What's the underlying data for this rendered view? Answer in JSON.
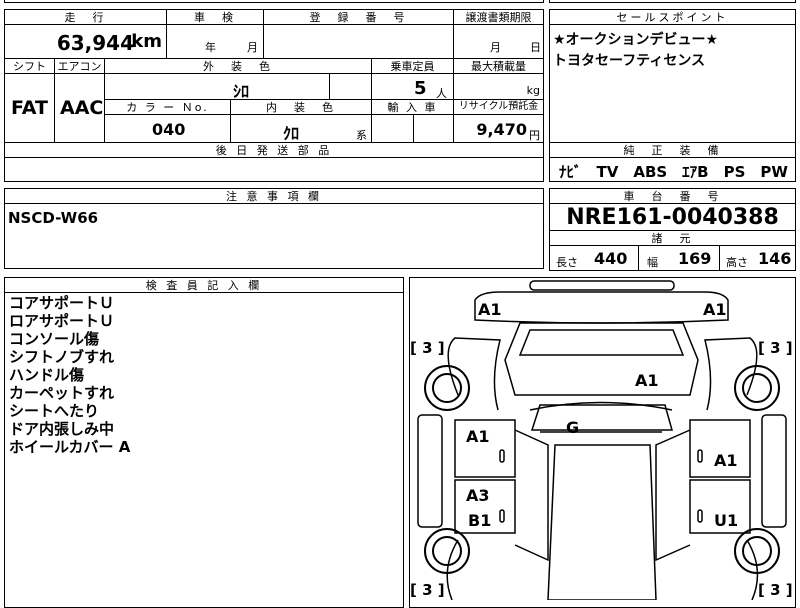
{
  "main_table": {
    "mileage_header": "走　行",
    "mileage_value": "63,944",
    "mileage_unit": "km",
    "inspection_header": "車　検",
    "inspection_year": "年",
    "inspection_month": "月",
    "registration_header": "登　録　番　号",
    "transfer_header": "譲渡書類期限",
    "transfer_month": "月",
    "transfer_day": "日",
    "shift_header": "シフト",
    "shift_value": "FAT",
    "aircon_header": "エアコン",
    "aircon_value": "AAC",
    "exterior_color_header": "外　装　色",
    "exterior_color_value": "ｼﾛ",
    "capacity_header": "乗車定員",
    "capacity_value": "5",
    "capacity_unit": "人",
    "max_load_header": "最大積載量",
    "max_load_unit": "kg",
    "color_no_header": "カ ラ ー Ｎo.",
    "color_no_value": "040",
    "interior_color_header": "内　装　色",
    "interior_color_value": "ｸﾛ",
    "interior_color_suffix": "系",
    "import_header": "輸 入 車",
    "recycle_header": "リサイクル預託金",
    "recycle_value": "9,470",
    "recycle_unit": "円",
    "parts_header": "後 日 発 送 部 品"
  },
  "sales_points": {
    "header": "セールスポイント",
    "lines": [
      "★オークションデビュー★",
      "トヨタセーフティセンス"
    ]
  },
  "equipment": {
    "header": "純　正　装　備",
    "value": "ﾅﾋﾞ　TV　ABS　ｴｱB　PS　PW"
  },
  "notes": {
    "header": "注 意 事 項 欄",
    "value": "NSCD-W66"
  },
  "chassis": {
    "header": "車　台　番　号",
    "value": "NRE161-0040388"
  },
  "dimensions": {
    "header": "諸　元",
    "length_label": "長さ",
    "length_value": "440",
    "width_label": "幅",
    "width_value": "169",
    "height_label": "高さ",
    "height_value": "146"
  },
  "inspector": {
    "header": "検 査 員 記 入 欄",
    "lines": [
      "コアサポートＵ",
      "ロアサポートＵ",
      "コンソール傷",
      "シフトノブすれ",
      "ハンドル傷",
      "カーペットすれ",
      "シートへたり",
      "ドア内張しみ中",
      "ホイールカバー A"
    ]
  },
  "diagram": {
    "front_left": "A1",
    "front_right": "A1",
    "hood": "A1",
    "roof": "G",
    "front_door_left": "A1",
    "front_door_right": "A1",
    "rear_door_left_a": "A3",
    "rear_door_left_b": "B1",
    "rear_door_right": "U1",
    "tire_front_left": "[ 3 ]",
    "tire_front_right": "[ 3 ]",
    "tire_rear_left": "[ 3 ]",
    "tire_rear_right": "[ 3 ]"
  }
}
